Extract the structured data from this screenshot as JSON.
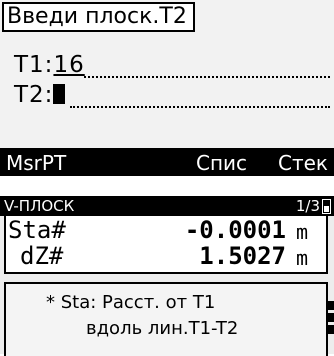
{
  "panel1": {
    "title": "Введи плоск.T2",
    "t1_label": "T1:",
    "t1_value": "16",
    "t2_label": "T2:",
    "softkeys": [
      "MsrPT",
      "Спис",
      "Стек"
    ]
  },
  "panel2": {
    "mode": "V-ПЛОСК",
    "page_indicator": "1/3",
    "rows": [
      {
        "label": "Sta#",
        "value": "-0.0001",
        "unit": "m"
      },
      {
        "label": "dZ#",
        "value": "1.5027",
        "unit": "m"
      }
    ],
    "note_line1": "* Sta: Расст. от T1",
    "note_line2": "вдоль лин.T1-T2"
  }
}
